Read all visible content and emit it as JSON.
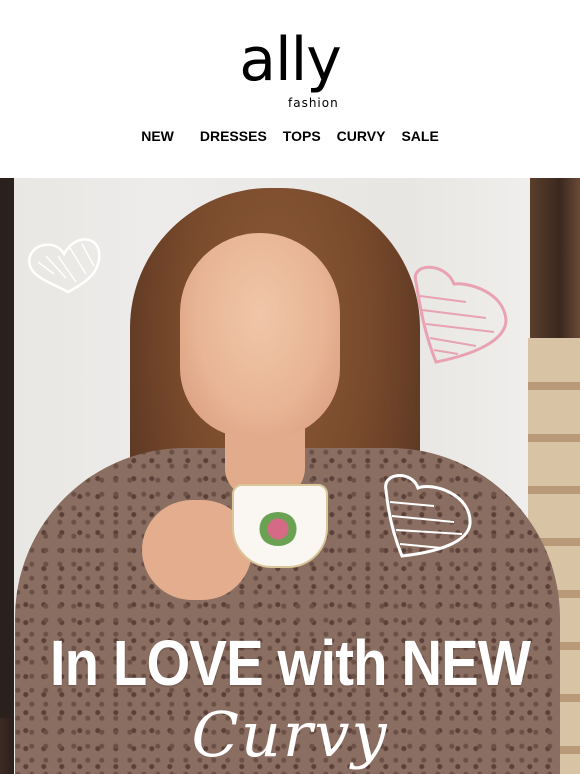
{
  "brand": {
    "logo_main": "ally",
    "logo_sub": "fashion"
  },
  "nav": {
    "items": [
      {
        "label": "NEW"
      },
      {
        "label": "DRESSES"
      },
      {
        "label": "TOPS"
      },
      {
        "label": "CURVY"
      },
      {
        "label": "SALE"
      }
    ]
  },
  "hero": {
    "headline": "In LOVE with NEW",
    "subline": "Curvy"
  },
  "colors": {
    "text": "#000000",
    "heart_pink": "#e8a2b2",
    "heart_white": "#ffffff",
    "headline": "#ffffff"
  }
}
